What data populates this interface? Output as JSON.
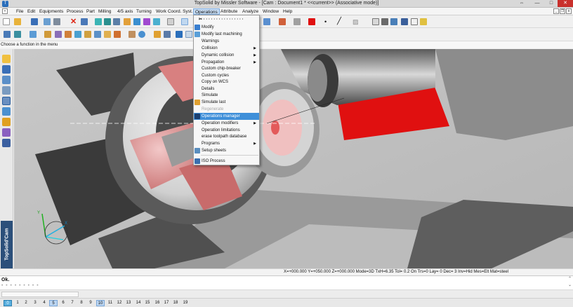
{
  "window": {
    "title": "TopSolid by Missler Software - [Cam : Document1 *  <<current>> (Associative mode)]",
    "minimize": "—",
    "maximize": "□",
    "close": "✕",
    "restore": "⇔"
  },
  "menubar": {
    "items": [
      "File",
      "Edit",
      "Equipments",
      "Process",
      "Part",
      "Milling",
      "4/5 axis",
      "Turning",
      "Work Coord. Syst.",
      "Operations",
      "Attribute",
      "Analyze",
      "Window",
      "Help"
    ],
    "active": "Operations",
    "mdi_controls": [
      "_",
      "❐",
      "x"
    ]
  },
  "hint": "Choose a function in the menu",
  "operations_menu": {
    "items": [
      {
        "label": "Modify",
        "icon": "modify-icon"
      },
      {
        "label": "Modify last machining",
        "icon": "modify-last-icon"
      },
      {
        "label": "Warnings"
      },
      {
        "label": "Collision",
        "submenu": true
      },
      {
        "label": "Dynamic collision",
        "submenu": true
      },
      {
        "label": "Propagation",
        "submenu": true
      },
      {
        "label": "Custom chip-breaker"
      },
      {
        "label": "Custom cycles"
      },
      {
        "label": "Copy on WCS"
      },
      {
        "label": "Details"
      },
      {
        "label": "Simulate"
      },
      {
        "label": "Simulate last",
        "icon": "simulate-last-icon"
      },
      {
        "label": "Regenerate",
        "disabled": true
      },
      {
        "label": "Operations manager",
        "selected": true,
        "icon": "operations-manager-icon"
      },
      {
        "label": "Operation modifiers",
        "submenu": true
      },
      {
        "label": "Operation limitations"
      },
      {
        "label": "erase toolpath database"
      },
      {
        "label": "Programs",
        "submenu": true
      },
      {
        "label": "Setup sheets",
        "icon": "setup-sheets-icon"
      },
      {
        "label": "ISO Process",
        "icon": "iso-process-icon"
      }
    ]
  },
  "coordinates": "X=+000.000  Y=+050.000  Z=+000.000  Mode=3D  TxH=6.35   Tol=  0.2   On  Trs=0   Lay=  0   Dec= 3   Inv=Hid  Mes=Elt  Mat=steel",
  "messages": {
    "status": "Ok.",
    "dashes": "- - - - - - - - -"
  },
  "brand": "TopSolid'Cam",
  "layers": [
    "0",
    "1",
    "2",
    "3",
    "4",
    "5",
    "6",
    "7",
    "8",
    "9",
    "10",
    "11",
    "12",
    "13",
    "14",
    "15",
    "16",
    "17",
    "18",
    "19"
  ],
  "selected_layers": [
    "5",
    "10"
  ],
  "colors": {
    "menu_highlight": "#3f8fd9",
    "accent_red": "#e01010",
    "part_pink": "#d88080"
  }
}
